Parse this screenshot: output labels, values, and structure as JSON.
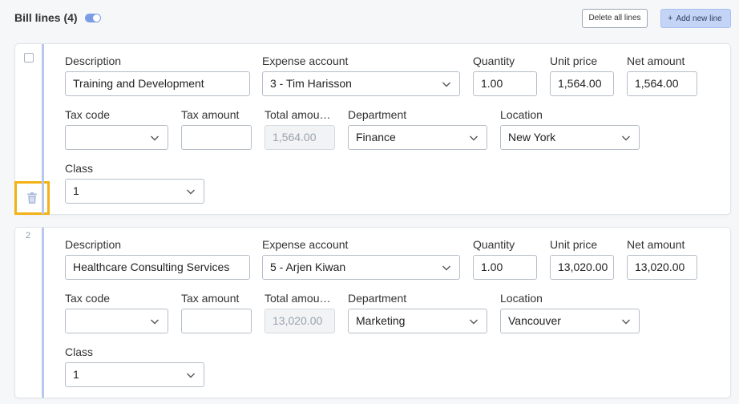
{
  "header": {
    "title": "Bill lines (4)",
    "toggle_on": true,
    "delete_all_label": "Delete all lines",
    "add_new_label": "Add new line"
  },
  "labels": {
    "description": "Description",
    "expense_account": "Expense account",
    "quantity": "Quantity",
    "unit_price": "Unit price",
    "net_amount": "Net amount",
    "tax_code": "Tax code",
    "tax_amount": "Tax amount",
    "total_amount": "Total amou…",
    "department": "Department",
    "location": "Location",
    "class": "Class"
  },
  "lines": [
    {
      "number": "",
      "description": "Training and Development",
      "expense_account": "3 - Tim Harisson",
      "quantity": "1.00",
      "unit_price": "1,564.00",
      "net_amount": "1,564.00",
      "tax_code": "",
      "tax_amount": "",
      "total_amount": "1,564.00",
      "department": "Finance",
      "location": "New York",
      "class": "1"
    },
    {
      "number": "2",
      "description": "Healthcare Consulting Services",
      "expense_account": "5 - Arjen Kiwan",
      "quantity": "1.00",
      "unit_price": "13,020.00",
      "net_amount": "13,020.00",
      "tax_code": "",
      "tax_amount": "",
      "total_amount": "13,020.00",
      "department": "Marketing",
      "location": "Vancouver",
      "class": "1"
    }
  ],
  "colors": {
    "accent": "#b9c7ee",
    "highlight": "#f2b213",
    "primary_button": "#c3d4f7"
  }
}
